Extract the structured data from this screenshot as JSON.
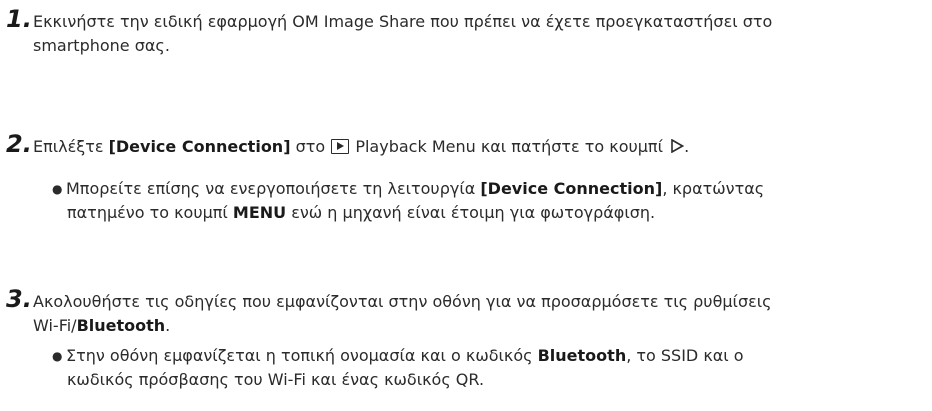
{
  "steps": [
    {
      "number": "1.",
      "line1": "Εκκινήστε την ειδική εφαρμογή OM Image Share που πρέπει να έχετε προεγκαταστήσει στο",
      "line2": "smartphone σας."
    },
    {
      "number": "2.",
      "text_a": "Επιλέξτε ",
      "bold_a": "[Device Connection]",
      "text_b": " στο ",
      "text_c": " Playback Menu και πατήστε το κουμπί ",
      "bullet": {
        "line1_a": "Μπορείτε επίσης να ενεργοποιήσετε τη λειτουργία ",
        "line1_bold": "[Device Connection]",
        "line1_b": ", κρατώντας",
        "line2_a": "πατημένο το κουμπί ",
        "line2_bold": "MENU",
        "line2_b": " ενώ η μηχανή είναι έτοιμη για φωτογράφιση."
      }
    },
    {
      "number": "3.",
      "line1": "Ακολουθήστε τις οδηγίες που εμφανίζονται στην οθόνη για να προσαρμόσετε τις ρυθμίσεις",
      "line2_a": "Wi-Fi/",
      "line2_bold": "Bluetooth",
      "line2_b": ".",
      "bullet": {
        "line1_a": "Στην οθόνη εμφανίζεται η τοπική ονομασία και ο κωδικός ",
        "line1_bold": "Bluetooth",
        "line1_b": ", το SSID και ο",
        "line2": "κωδικός πρόσβασης του Wi-Fi και ένας κωδικός QR."
      }
    }
  ],
  "icons": {
    "playback": "playback-icon",
    "right_arrow": "right-arrow-icon"
  }
}
